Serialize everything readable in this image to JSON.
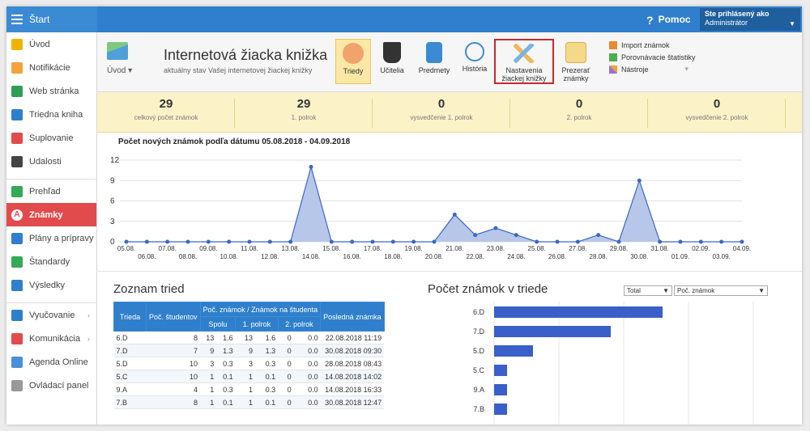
{
  "topbar": {
    "start_label": "Štart",
    "help_label": "Pomoc",
    "user_line1": "Ste prihlásený ako",
    "user_line2": "Administrátor"
  },
  "sidebar": {
    "items": [
      {
        "label": "Úvod",
        "icon": "star-icon",
        "color": "#f0b400"
      },
      {
        "label": "Notifikácie",
        "icon": "envelope-icon",
        "color": "#f2a43a"
      },
      {
        "label": "Web stránka",
        "icon": "home-icon",
        "color": "#2e9d56"
      },
      {
        "label": "Triedna kniha",
        "icon": "book-icon",
        "color": "#2f7fcc"
      },
      {
        "label": "Suplovanie",
        "icon": "person-icon",
        "color": "#e24b4b"
      },
      {
        "label": "Udalosti",
        "icon": "calendar-icon",
        "color": "#444444"
      },
      {
        "label": "Prehľad",
        "icon": "check-circle-icon",
        "color": "#33aa55"
      },
      {
        "label": "Známky",
        "icon": "grade-icon",
        "color": "#e24b4b",
        "active": true
      },
      {
        "label": "Plány a prípravy",
        "icon": "briefcase-icon",
        "color": "#2f7fcc"
      },
      {
        "label": "Štandardy",
        "icon": "shield-icon",
        "color": "#33aa55"
      },
      {
        "label": "Výsledky",
        "icon": "bar-chart-icon",
        "color": "#2f7fcc"
      },
      {
        "label": "Vyučovanie",
        "icon": "blackboard-icon",
        "color": "#2f7fcc",
        "arrow": true
      },
      {
        "label": "Komunikácia",
        "icon": "chat-icon",
        "color": "#e24b4b",
        "arrow": true
      },
      {
        "label": "Agenda Online",
        "icon": "pen-icon",
        "color": "#4a90d9"
      },
      {
        "label": "Ovládací panel",
        "icon": "gear-icon",
        "color": "#999999"
      }
    ]
  },
  "ribbon": {
    "uvod_label": "Úvod",
    "title": "Internetová žiacka knižka",
    "subtitle": "aktuálny stav Vašej internetovej žiackej knižky",
    "buttons": [
      {
        "label": "Triedy",
        "icon": "people-icon"
      },
      {
        "label": "Učitelia",
        "icon": "graduation-cap-icon"
      },
      {
        "label": "Predmety",
        "icon": "notebook-icon"
      },
      {
        "label": "História",
        "icon": "clock-icon"
      },
      {
        "label": "Nastavenia žiackej knižky",
        "icon": "pencil-ruler-icon"
      },
      {
        "label": "Prezerať známky",
        "icon": "folder-icon"
      }
    ],
    "tools": [
      "Import známok",
      "Porovnávacie štatistiky",
      "Nástroje"
    ]
  },
  "stats": [
    {
      "value": "29",
      "label": "celkový počet známok"
    },
    {
      "value": "29",
      "label": "1. polrok"
    },
    {
      "value": "0",
      "label": "vysvedčenie 1. polrok"
    },
    {
      "value": "0",
      "label": "2. polrok"
    },
    {
      "value": "0",
      "label": "vysvedčenie 2. polrok"
    }
  ],
  "chart_data": [
    {
      "type": "area",
      "title": "Počet nových známok podľa dátumu 05.08.2018 - 04.09.2018",
      "ylim": [
        0,
        12
      ],
      "yticks": [
        0,
        3,
        6,
        9,
        12
      ],
      "x": [
        "05.08.",
        "06.08.",
        "07.08.",
        "08.08.",
        "09.08.",
        "10.08.",
        "11.08.",
        "12.08.",
        "13.08.",
        "14.08.",
        "15.08.",
        "16.08.",
        "17.08.",
        "18.08.",
        "19.08.",
        "20.08.",
        "21.08.",
        "22.08.",
        "23.08.",
        "24.08.",
        "25.08.",
        "26.08.",
        "27.08.",
        "28.08.",
        "29.08.",
        "30.08.",
        "31.08.",
        "01.09.",
        "02.09.",
        "03.09.",
        "04.09."
      ],
      "values": [
        0,
        0,
        0,
        0,
        0,
        0,
        0,
        0,
        0,
        11,
        0,
        0,
        0,
        0,
        0,
        0,
        4,
        1,
        2,
        1,
        0,
        0,
        0,
        1,
        0,
        9,
        0,
        0,
        0,
        0,
        0
      ],
      "grid": true,
      "color": "#3a68c6"
    },
    {
      "type": "bar",
      "title": "Počet známok v triede",
      "orientation": "horizontal",
      "categories": [
        "6.D",
        "7.D",
        "5.D",
        "5.C",
        "9.A",
        "7.B"
      ],
      "values": [
        13,
        9,
        3,
        1,
        1,
        1
      ],
      "xlim": [
        0,
        20
      ],
      "color": "#3a5fc8"
    }
  ],
  "table": {
    "title": "Zoznam tried",
    "headers": {
      "trieda": "Trieda",
      "pocet": "Poč. študentov",
      "group": "Poč. známok / Známok na študenta",
      "spolu": "Spolu",
      "p1": "1. polrok",
      "p2": "2. polrok",
      "posledna": "Posledná známka"
    },
    "rows": [
      [
        "6.D",
        "8",
        "13",
        "1.6",
        "13",
        "1.6",
        "0",
        "0.0",
        "22.08.2018 11:19"
      ],
      [
        "7.D",
        "7",
        "9",
        "1.3",
        "9",
        "1.3",
        "0",
        "0.0",
        "30.08.2018 09:30"
      ],
      [
        "5.D",
        "10",
        "3",
        "0.3",
        "3",
        "0.3",
        "0",
        "0.0",
        "28.08.2018 08:43"
      ],
      [
        "5.C",
        "10",
        "1",
        "0.1",
        "1",
        "0.1",
        "0",
        "0.0",
        "14.08.2018 14:02"
      ],
      [
        "9.A",
        "4",
        "1",
        "0.3",
        "1",
        "0.3",
        "0",
        "0.0",
        "14.08.2018 16:33"
      ],
      [
        "7.B",
        "8",
        "1",
        "0.1",
        "1",
        "0.1",
        "0",
        "0.0",
        "30.08.2018 12:47"
      ]
    ]
  },
  "bar_section": {
    "title": "Počet známok v triede",
    "select1": "Total",
    "select2": "Poč. známok"
  }
}
